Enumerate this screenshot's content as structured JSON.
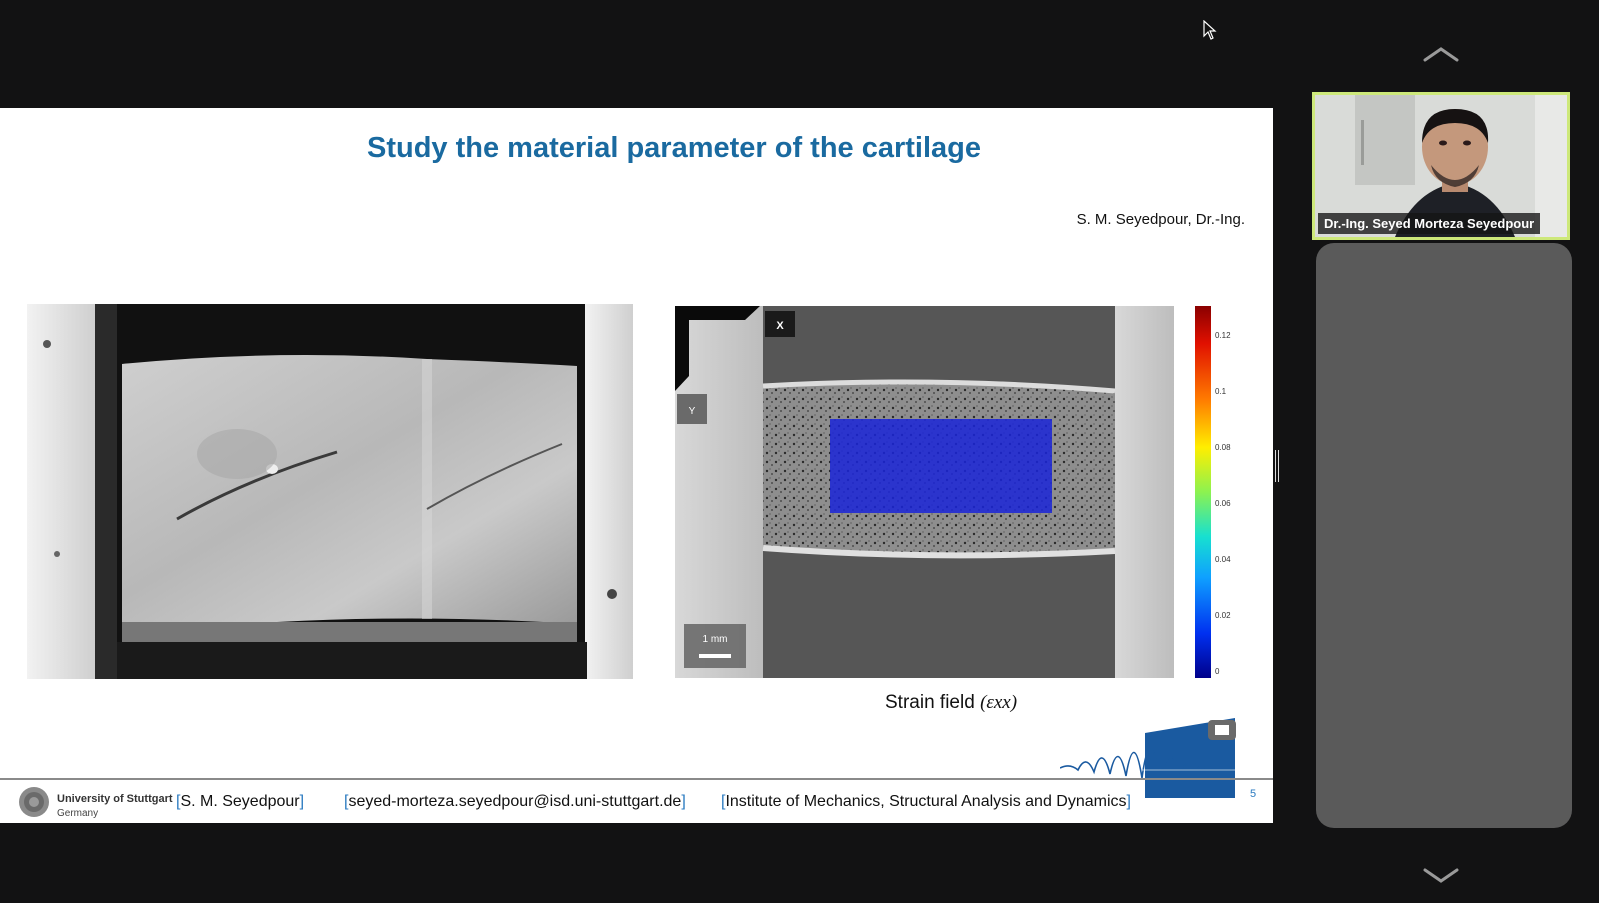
{
  "slide": {
    "title": "Study the material parameter of the cartilage",
    "author": "S. M. Seyedpour, Dr.-Ing.",
    "strain_caption_text": "Strain field",
    "strain_caption_math": "(εxx)",
    "scale_bar_label": "1 mm",
    "axis_x_label": "X",
    "axis_y_label": "Y",
    "colorbar_ticks": [
      "0.12",
      "0.1",
      "0.08",
      "0.06",
      "0.04",
      "0.02",
      "0"
    ],
    "page_number": "5"
  },
  "footer": {
    "university_name": "University of Stuttgart",
    "university_country": "Germany",
    "name": "S. M. Seyedpour",
    "email": "seyed-morteza.seyedpour@isd.uni-stuttgart.de",
    "institute": "Institute of Mechanics, Structural Analysis and Dynamics"
  },
  "video": {
    "participant_name": "Dr.-Ing. Seyed Morteza Seyedpour"
  },
  "colors": {
    "title_blue": "#1a6aa0",
    "speaker_highlight": "#cde87a",
    "background": "#121213"
  }
}
